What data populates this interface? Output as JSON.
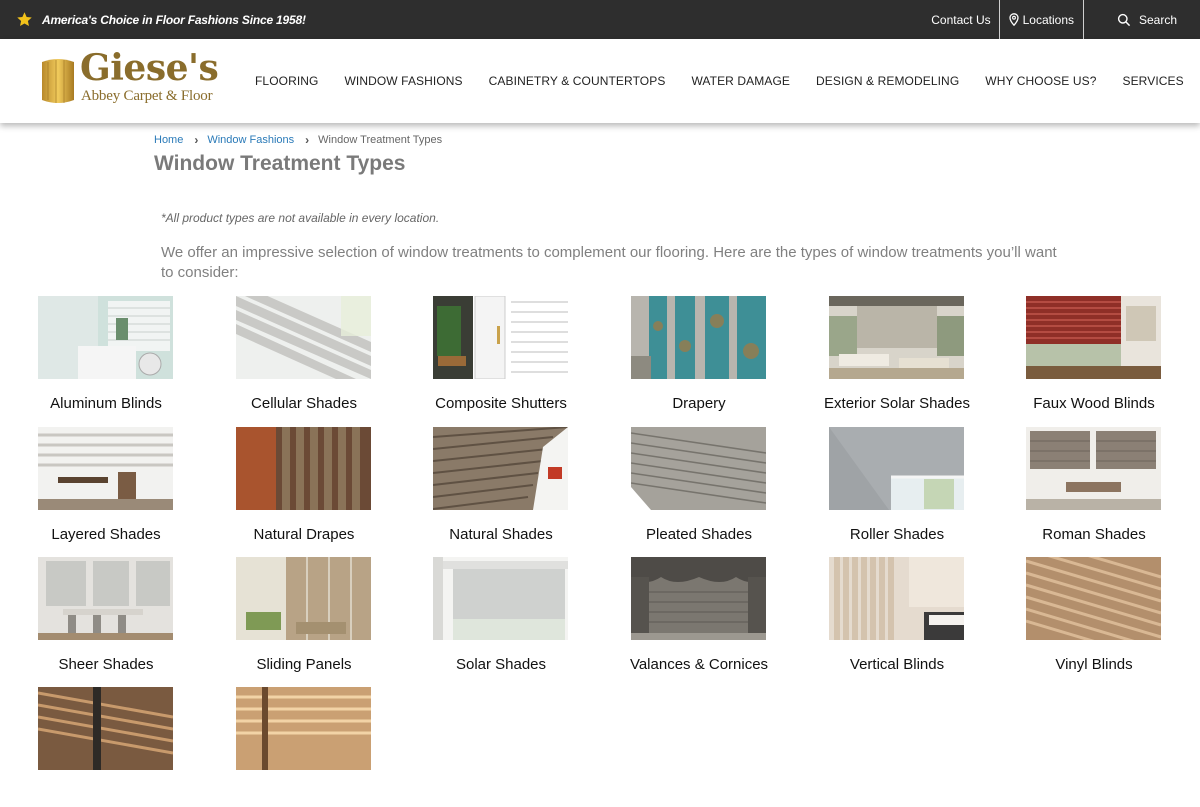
{
  "topbar": {
    "tagline": "America's Choice in Floor Fashions Since 1958!",
    "contact_label": "Contact Us",
    "locations_label": "Locations",
    "search_label": "Search"
  },
  "logo": {
    "name": "Giese's",
    "sub": "Abbey Carpet & Floor"
  },
  "nav": [
    "FLOORING",
    "WINDOW FASHIONS",
    "CABINETRY & COUNTERTOPS",
    "WATER DAMAGE",
    "DESIGN & REMODELING",
    "WHY CHOOSE US?",
    "SERVICES"
  ],
  "breadcrumb": {
    "home": "Home",
    "parent": "Window Fashions",
    "current": "Window Treatment Types"
  },
  "page": {
    "title": "Window Treatment Types",
    "note": "*All product types are not available in every location.",
    "intro": "We offer an impressive selection of window treatments to complement our flooring. Here are the types of window treatments you’ll want to consider:"
  },
  "products": [
    "Aluminum Blinds",
    "Cellular Shades",
    "Composite Shutters",
    "Drapery",
    "Exterior Solar Shades",
    "Faux Wood Blinds",
    "Layered Shades",
    "Natural Drapes",
    "Natural Shades",
    "Pleated Shades",
    "Roller Shades",
    "Roman Shades",
    "Sheer Shades",
    "Sliding Panels",
    "Solar Shades",
    "Valances & Cornices",
    "Vertical Blinds",
    "Vinyl Blinds",
    "",
    ""
  ],
  "colors": {
    "topbar_bg": "#2e2e2e",
    "link": "#2a7ab8",
    "brand_gold": "#8a6d2c",
    "star": "#f2c21b"
  }
}
